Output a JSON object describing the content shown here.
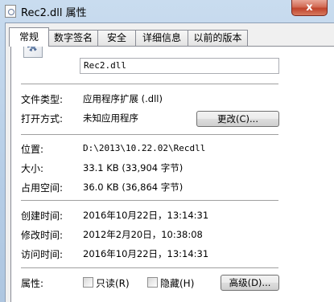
{
  "window": {
    "title": "Rec2.dll 属性",
    "close_symbol": "x",
    "file_icon": "dll-file-icon"
  },
  "tabs": [
    {
      "label": "常规"
    },
    {
      "label": "数字签名"
    },
    {
      "label": "安全"
    },
    {
      "label": "详细信息"
    },
    {
      "label": "以前的版本"
    }
  ],
  "general": {
    "file_name": "Rec2.dll",
    "file_type_label": "文件类型:",
    "file_type_value": "应用程序扩展 (.dll)",
    "open_with_label": "打开方式:",
    "open_with_value": "未知应用程序",
    "change_button": "更改(C)...",
    "location_label": "位置:",
    "location_value": "D:\\2013\\10.22.02\\Recdll",
    "size_label": "大小:",
    "size_value": "33.1 KB (33,904 字节)",
    "disk_size_label": "占用空间:",
    "disk_size_value": "36.0 KB (36,864 字节)",
    "created_label": "创建时间:",
    "created_value": "2016年10月22日，13:14:31",
    "modified_label": "修改时间:",
    "modified_value": "2012年2月20日，10:38:08",
    "accessed_label": "访问时间:",
    "accessed_value": "2016年10月22日，13:14:31",
    "attributes_label": "属性:",
    "readonly_label": "只读(R)",
    "hidden_label": "隐藏(H)",
    "advanced_button": "高级(D)..."
  }
}
